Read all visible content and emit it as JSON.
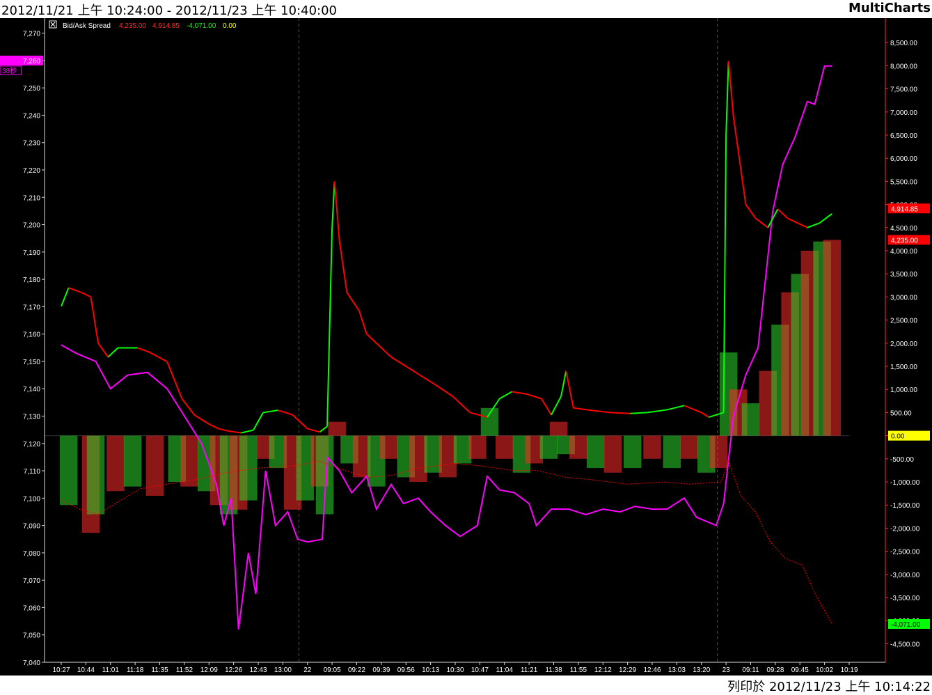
{
  "header": {
    "title": "2012/11/21 上午 10:24:00 - 2012/11/23 上午 10:40:00",
    "brand": "MultiCharts"
  },
  "footer": {
    "printed": "列印於 2012/11/23 上午 10:14:22"
  },
  "legend": {
    "study": "Bid/Ask Spread",
    "v1": "4,235.00",
    "v2": "4,914.85",
    "v3": "-4,071.00",
    "v4": "0.00"
  },
  "colors": {
    "background": "#000000",
    "price": "#ff00ff",
    "up": "#00ff00",
    "down": "#ff0000",
    "zero": "#ffff00",
    "left_axis": "#ffffff",
    "right_axis": "#ff3030"
  },
  "chart_data": {
    "type": "line",
    "x_tick_labels": [
      "10:27",
      "10:44",
      "11:01",
      "11:18",
      "11:35",
      "11:52",
      "12:09",
      "12:26",
      "12:43",
      "13:00",
      "22",
      "09:05",
      "09:22",
      "09:39",
      "09:56",
      "10:13",
      "10:30",
      "10:47",
      "11:04",
      "11:21",
      "11:38",
      "11:55",
      "12:12",
      "12:29",
      "12:46",
      "13:03",
      "13:20",
      "23",
      "09:11",
      "09:28",
      "09:45",
      "10:02",
      "10:19"
    ],
    "session_breaks": [
      "22",
      "23"
    ],
    "left_axis": {
      "ylim": [
        7040,
        7275
      ],
      "ticks": [
        "7,270",
        "7,260",
        "7,250",
        "7,240",
        "7,230",
        "7,220",
        "7,210",
        "7,200",
        "7,190",
        "7,180",
        "7,170",
        "7,160",
        "7,150",
        "7,140",
        "7,130",
        "7,120",
        "7,110",
        "7,100",
        "7,090",
        "7,080",
        "7,070",
        "7,060",
        "7,050",
        "7,040"
      ],
      "last_price_marker": "7,260",
      "timer_label": "38秒"
    },
    "right_axis": {
      "ylim": [
        -4900,
        9000
      ],
      "ticks": [
        "8,500.00",
        "8,000.00",
        "7,500.00",
        "7,000.00",
        "6,500.00",
        "6,000.00",
        "5,500.00",
        "5,000.00",
        "4,500.00",
        "4,000.00",
        "3,500.00",
        "3,000.00",
        "2,500.00",
        "2,000.00",
        "1,500.00",
        "1,000.00",
        "500.00",
        "0.00",
        "-500.00",
        "-1,000.00",
        "-1,500.00",
        "-2,000.00",
        "-2,500.00",
        "-3,000.00",
        "-3,500.00",
        "-4,000.00",
        "-4,500.00"
      ],
      "markers": [
        {
          "label": "4,914.85",
          "value": 4914.85,
          "color": "#ff0000"
        },
        {
          "label": "4,235.00",
          "value": 4235,
          "color": "#ff0000"
        },
        {
          "label": "0.00",
          "value": 0,
          "color": "#ffff00"
        },
        {
          "label": "-4,071.00",
          "value": -4071,
          "color": "#00ff00"
        }
      ]
    },
    "series": [
      {
        "name": "price",
        "axis": "left",
        "color": "#ff00ff",
        "points": [
          [
            0,
            7156
          ],
          [
            0.6,
            7153
          ],
          [
            1.4,
            7150
          ],
          [
            2,
            7140
          ],
          [
            2.7,
            7145
          ],
          [
            3.5,
            7146
          ],
          [
            4.3,
            7140
          ],
          [
            5,
            7130
          ],
          [
            5.7,
            7120
          ],
          [
            6.3,
            7105
          ],
          [
            6.6,
            7090
          ],
          [
            6.9,
            7100
          ],
          [
            7.2,
            7052
          ],
          [
            7.6,
            7080
          ],
          [
            7.9,
            7065
          ],
          [
            8.3,
            7110
          ],
          [
            8.7,
            7090
          ],
          [
            9.2,
            7095
          ],
          [
            9.6,
            7085
          ],
          [
            10,
            7084
          ],
          [
            10.6,
            7085
          ],
          [
            10.8,
            7115
          ],
          [
            11.3,
            7110
          ],
          [
            11.8,
            7102
          ],
          [
            12.4,
            7108
          ],
          [
            12.8,
            7096
          ],
          [
            13.4,
            7105
          ],
          [
            13.9,
            7098
          ],
          [
            14.5,
            7100
          ],
          [
            15,
            7095
          ],
          [
            15.6,
            7090
          ],
          [
            16.2,
            7086
          ],
          [
            16.9,
            7090
          ],
          [
            17.3,
            7108
          ],
          [
            17.8,
            7103
          ],
          [
            18.4,
            7102
          ],
          [
            19,
            7098
          ],
          [
            19.3,
            7090
          ],
          [
            19.9,
            7096
          ],
          [
            20.6,
            7096
          ],
          [
            21.3,
            7094
          ],
          [
            22,
            7096
          ],
          [
            22.7,
            7095
          ],
          [
            23.3,
            7097
          ],
          [
            24,
            7096
          ],
          [
            24.6,
            7096
          ],
          [
            25.3,
            7100
          ],
          [
            25.8,
            7093
          ],
          [
            26.6,
            7090
          ],
          [
            26.9,
            7098
          ],
          [
            27.3,
            7130
          ],
          [
            27.8,
            7145
          ],
          [
            28.3,
            7155
          ],
          [
            28.9,
            7205
          ],
          [
            29.3,
            7222
          ],
          [
            29.8,
            7232
          ],
          [
            30.3,
            7245
          ],
          [
            30.6,
            7244
          ],
          [
            31,
            7258
          ],
          [
            31.3,
            7258
          ]
        ]
      },
      {
        "name": "bid_ask_line",
        "axis": "right",
        "color": "#00ff00",
        "alt_color": "#ff0000",
        "points": [
          [
            0,
            2800
          ],
          [
            0.3,
            3200
          ],
          [
            0.8,
            3100
          ],
          [
            1.2,
            3000
          ],
          [
            1.5,
            2000
          ],
          [
            1.9,
            1700
          ],
          [
            2.3,
            1900
          ],
          [
            3.1,
            1900
          ],
          [
            3.6,
            1800
          ],
          [
            4.3,
            1600
          ],
          [
            4.9,
            800
          ],
          [
            5.4,
            450
          ],
          [
            6,
            250
          ],
          [
            6.4,
            150
          ],
          [
            6.8,
            100
          ],
          [
            7.3,
            60
          ],
          [
            7.8,
            120
          ],
          [
            8.2,
            500
          ],
          [
            8.8,
            550
          ],
          [
            9.4,
            450
          ],
          [
            10,
            150
          ],
          [
            10.5,
            80
          ],
          [
            10.8,
            200
          ],
          [
            11,
            4500
          ],
          [
            11.1,
            5500
          ],
          [
            11.3,
            4200
          ],
          [
            11.6,
            3100
          ],
          [
            12.1,
            2700
          ],
          [
            12.4,
            2200
          ],
          [
            13,
            1900
          ],
          [
            13.4,
            1700
          ],
          [
            14,
            1500
          ],
          [
            14.6,
            1300
          ],
          [
            15.2,
            1100
          ],
          [
            15.9,
            850
          ],
          [
            16.6,
            500
          ],
          [
            17.3,
            400
          ],
          [
            17.8,
            800
          ],
          [
            18.3,
            950
          ],
          [
            18.9,
            900
          ],
          [
            19.5,
            800
          ],
          [
            19.9,
            450
          ],
          [
            20.3,
            850
          ],
          [
            20.5,
            1400
          ],
          [
            20.8,
            600
          ],
          [
            21.5,
            550
          ],
          [
            22.3,
            500
          ],
          [
            23.1,
            480
          ],
          [
            23.8,
            500
          ],
          [
            24.6,
            560
          ],
          [
            25.3,
            650
          ],
          [
            26,
            500
          ],
          [
            26.3,
            400
          ],
          [
            26.9,
            500
          ],
          [
            27,
            6500
          ],
          [
            27.1,
            8100
          ],
          [
            27.3,
            6900
          ],
          [
            27.8,
            5000
          ],
          [
            28.2,
            4700
          ],
          [
            28.7,
            4500
          ],
          [
            29.1,
            4900
          ],
          [
            29.5,
            4700
          ],
          [
            30.3,
            4500
          ],
          [
            30.8,
            4600
          ],
          [
            31.3,
            4800
          ]
        ]
      },
      {
        "name": "dotted_line",
        "axis": "right",
        "color": "#ff0000",
        "dotted": true,
        "points": [
          [
            0,
            -1400
          ],
          [
            0.8,
            -1600
          ],
          [
            1.5,
            -1700
          ],
          [
            2.4,
            -1400
          ],
          [
            3.2,
            -1150
          ],
          [
            4.3,
            -1050
          ],
          [
            5.5,
            -950
          ],
          [
            6.7,
            -800
          ],
          [
            8,
            -700
          ],
          [
            9.5,
            -650
          ],
          [
            10.5,
            -550
          ],
          [
            11.5,
            -750
          ],
          [
            12.5,
            -900
          ],
          [
            13.5,
            -850
          ],
          [
            14.5,
            -700
          ],
          [
            16,
            -600
          ],
          [
            17,
            -650
          ],
          [
            18.3,
            -750
          ],
          [
            19.3,
            -750
          ],
          [
            20.5,
            -900
          ],
          [
            21.5,
            -950
          ],
          [
            23,
            -1050
          ],
          [
            24.5,
            -1000
          ],
          [
            25.5,
            -1050
          ],
          [
            26.8,
            -1000
          ],
          [
            27.1,
            -550
          ],
          [
            27.6,
            -1300
          ],
          [
            28.2,
            -1650
          ],
          [
            28.8,
            -2300
          ],
          [
            29.4,
            -2650
          ],
          [
            30.1,
            -2800
          ],
          [
            30.6,
            -3400
          ],
          [
            31.3,
            -4071
          ]
        ]
      }
    ],
    "histogram": {
      "axis": "right",
      "width_ratio": 0.72,
      "bars": [
        [
          0.3,
          -1500
        ],
        [
          1.2,
          -2100
        ],
        [
          1.4,
          -1700
        ],
        [
          2.2,
          -1200
        ],
        [
          2.9,
          -1100
        ],
        [
          3.8,
          -1300
        ],
        [
          4.7,
          -1000
        ],
        [
          5.2,
          -1100
        ],
        [
          5.9,
          -1200
        ],
        [
          6.4,
          -1500
        ],
        [
          6.8,
          -1700
        ],
        [
          7.2,
          -1600
        ],
        [
          7.6,
          -1400
        ],
        [
          8.3,
          -500
        ],
        [
          8.8,
          -700
        ],
        [
          9.4,
          -1600
        ],
        [
          9.9,
          -1400
        ],
        [
          10.5,
          -1100
        ],
        [
          10.7,
          -1700
        ],
        [
          11.2,
          300
        ],
        [
          11.7,
          -600
        ],
        [
          12.2,
          -900
        ],
        [
          12.8,
          -1100
        ],
        [
          13.3,
          -500
        ],
        [
          14,
          -900
        ],
        [
          14.5,
          -1000
        ],
        [
          15.1,
          -800
        ],
        [
          15.7,
          -900
        ],
        [
          16.3,
          -600
        ],
        [
          16.9,
          -500
        ],
        [
          17.4,
          600
        ],
        [
          18,
          -500
        ],
        [
          18.7,
          -800
        ],
        [
          19.2,
          -600
        ],
        [
          19.8,
          -500
        ],
        [
          20.2,
          300
        ],
        [
          20.5,
          -400
        ],
        [
          21,
          -500
        ],
        [
          21.7,
          -700
        ],
        [
          22.4,
          -800
        ],
        [
          23.2,
          -700
        ],
        [
          24,
          -500
        ],
        [
          24.8,
          -700
        ],
        [
          25.5,
          -500
        ],
        [
          26.2,
          -800
        ],
        [
          26.7,
          -700
        ],
        [
          27.1,
          1800
        ],
        [
          27.5,
          1000
        ],
        [
          28,
          700
        ],
        [
          28.7,
          1400
        ],
        [
          29.2,
          2400
        ],
        [
          29.6,
          3100
        ],
        [
          30,
          3500
        ],
        [
          30.4,
          4000
        ],
        [
          30.9,
          4200
        ],
        [
          31.3,
          4235
        ]
      ]
    }
  }
}
